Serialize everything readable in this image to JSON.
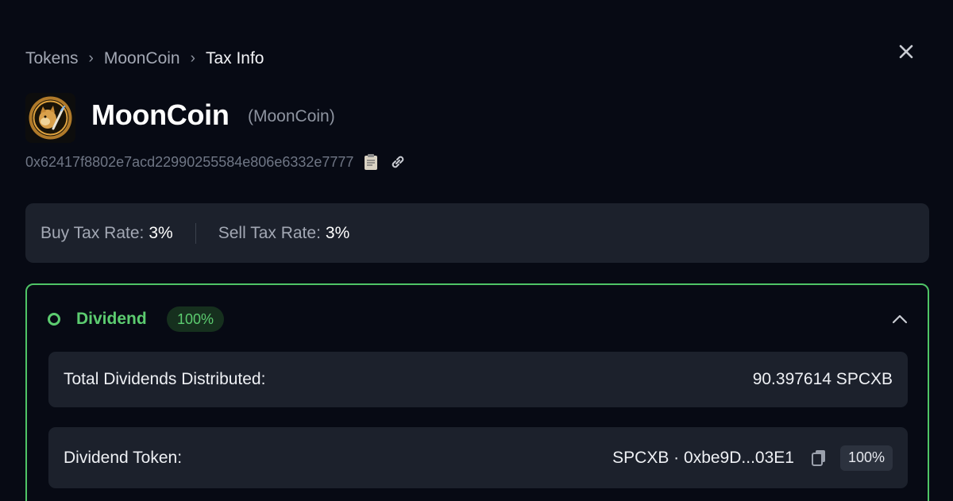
{
  "breadcrumb": {
    "items": [
      "Tokens",
      "MoonCoin",
      "Tax Info"
    ],
    "separator": "›"
  },
  "close_icon": "close-icon",
  "token": {
    "name": "MoonCoin",
    "symbol": "(MoonCoin)",
    "address": "0x62417f8802e7acd22990255584e806e6332e7777",
    "logo_icon": "moon-doge-logo"
  },
  "tax": {
    "buy_label": "Buy Tax Rate:",
    "buy_value": "3%",
    "sell_label": "Sell Tax Rate:",
    "sell_value": "3%"
  },
  "dividend": {
    "title": "Dividend",
    "percent": "100%",
    "accent_color": "#5ccc70",
    "total_label": "Total Dividends Distributed:",
    "total_value": "90.397614 SPCXB",
    "token_label": "Dividend Token:",
    "token_value": "SPCXB · 0xbe9D...03E1",
    "token_share": "100%"
  }
}
